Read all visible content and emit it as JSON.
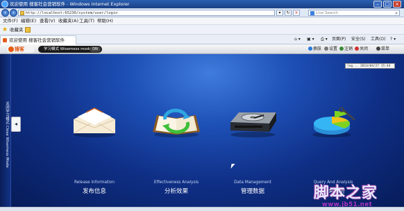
{
  "window": {
    "title": "欢迎使用  搜客社会营销软件 - Windows Internet Explorer"
  },
  "address": {
    "url": "http://localhost:65230/system/user/login",
    "search_placeholder": "Live Search"
  },
  "menu": {
    "items": [
      "文件(F)",
      "编辑(E)",
      "查看(V)",
      "收藏夹(A)",
      "工具(T)",
      "帮助(H)"
    ]
  },
  "favorites": {
    "label": "收藏夹"
  },
  "tab": {
    "label": "欢迎使用  搜客社会营销软件"
  },
  "toolbar": {
    "page": "页面(P)",
    "safety": "安全(S)",
    "tools": "工具(O)"
  },
  "app": {
    "logo": "搜客",
    "mode_label": "学习模式 Wisemess model",
    "mode_toggle": "ON",
    "actions": [
      "换肤",
      "设置",
      "注销",
      "关闭",
      "菜单"
    ],
    "clock": "log... 2014/04/27 15:44",
    "sidebar_text": "关闭学习模式 Close Wisemess Mode",
    "modules": [
      {
        "en": "Release Information",
        "cn": "发布信息",
        "icon": "envelope-icon"
      },
      {
        "en": "Effectiveness Analysis",
        "cn": "分析效果",
        "icon": "book-refresh-icon"
      },
      {
        "en": "Data Management",
        "cn": "管理数据",
        "icon": "hard-drive-icon"
      },
      {
        "en": "Query And Analysis",
        "cn": "查询分析",
        "icon": "pie-chart-icon"
      }
    ]
  },
  "watermark": {
    "brand": "脚本之家",
    "url": "www.jb51.net"
  },
  "colors": {
    "title_bar": "#1a3f86",
    "app_bg": "#1d4fb5",
    "logo": "#e25410",
    "watermark": "#b034c4"
  }
}
